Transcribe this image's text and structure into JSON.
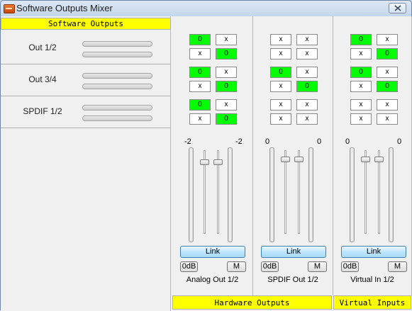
{
  "window": {
    "title": "Software Outputs Mixer"
  },
  "left": {
    "header": "Software Outputs",
    "outputs": [
      {
        "label": "Out 1/2"
      },
      {
        "label": "Out 3/4"
      },
      {
        "label": "SPDIF 1/2"
      }
    ]
  },
  "strips": [
    {
      "name": "Analog Out 1/2",
      "db_left": "-2",
      "db_right": "-2",
      "routing": [
        [
          "0",
          "x"
        ],
        [
          "x",
          "0"
        ],
        [
          "0",
          "x"
        ],
        [
          "x",
          "0"
        ],
        [
          "0",
          "x"
        ],
        [
          "x",
          "0"
        ]
      ],
      "routing_on": [
        [
          true,
          false
        ],
        [
          false,
          true
        ],
        [
          true,
          false
        ],
        [
          false,
          true
        ],
        [
          true,
          false
        ],
        [
          false,
          true
        ]
      ],
      "link_label": "Link",
      "zero_label": "0dB",
      "mute_label": "M"
    },
    {
      "name": "SPDIF Out 1/2",
      "db_left": "0",
      "db_right": "0",
      "routing": [
        [
          "x",
          "x"
        ],
        [
          "x",
          "x"
        ],
        [
          "0",
          "x"
        ],
        [
          "x",
          "0"
        ],
        [
          "x",
          "x"
        ],
        [
          "x",
          "x"
        ]
      ],
      "routing_on": [
        [
          false,
          false
        ],
        [
          false,
          false
        ],
        [
          true,
          false
        ],
        [
          false,
          true
        ],
        [
          false,
          false
        ],
        [
          false,
          false
        ]
      ],
      "link_label": "Link",
      "zero_label": "0dB",
      "mute_label": "M"
    },
    {
      "name": "Virtual In 1/2",
      "db_left": "0",
      "db_right": "0",
      "routing": [
        [
          "0",
          "x"
        ],
        [
          "x",
          "0"
        ],
        [
          "0",
          "x"
        ],
        [
          "x",
          "0"
        ],
        [
          "x",
          "x"
        ],
        [
          "x",
          "x"
        ]
      ],
      "routing_on": [
        [
          true,
          false
        ],
        [
          false,
          true
        ],
        [
          true,
          false
        ],
        [
          false,
          true
        ],
        [
          false,
          false
        ],
        [
          false,
          false
        ]
      ],
      "link_label": "Link",
      "zero_label": "0dB",
      "mute_label": "M"
    }
  ],
  "footer": {
    "hardware_outputs": "Hardware Outputs",
    "virtual_inputs": "Virtual Inputs"
  },
  "colors": {
    "active_cell": "#00ff00",
    "header_bg": "#ffff00",
    "link_button": "#bee6fd"
  }
}
